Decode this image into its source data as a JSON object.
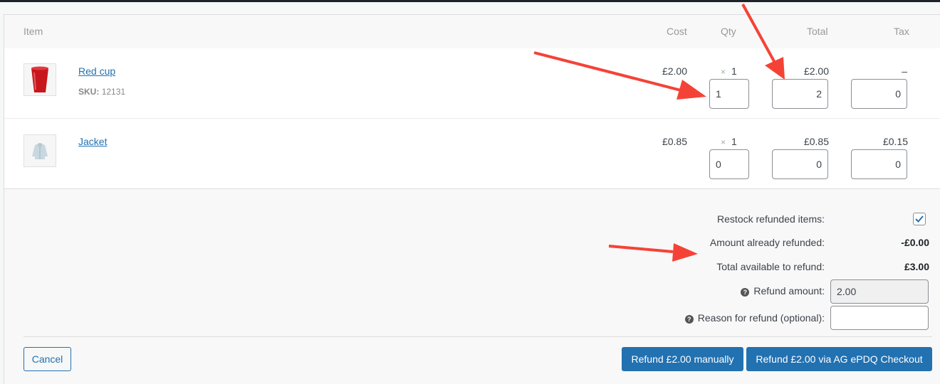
{
  "table": {
    "headers": {
      "item": "Item",
      "cost": "Cost",
      "qty": "Qty",
      "total": "Total",
      "tax": "Tax"
    },
    "rows": [
      {
        "name": "Red cup",
        "sku_label": "SKU:",
        "sku_value": "12131",
        "cost": "£2.00",
        "qty_prefix": "×",
        "qty": "1",
        "total": "£2.00",
        "tax": "–",
        "refund_qty": "1",
        "refund_total": "2",
        "refund_tax": "0"
      },
      {
        "name": "Jacket",
        "cost": "£0.85",
        "qty_prefix": "×",
        "qty": "1",
        "total": "£0.85",
        "tax": "£0.15",
        "refund_qty": "0",
        "refund_total": "0",
        "refund_tax": "0"
      }
    ]
  },
  "refund": {
    "restock_label": "Restock refunded items:",
    "restock_checked": true,
    "already_refunded_label": "Amount already refunded:",
    "already_refunded_value": "-£0.00",
    "available_label": "Total available to refund:",
    "available_value": "£3.00",
    "amount_label": "Refund amount:",
    "amount_value": "2.00",
    "reason_label": "Reason for refund (optional):",
    "reason_value": ""
  },
  "actions": {
    "cancel": "Cancel",
    "refund_manual": "Refund £2.00 manually",
    "refund_gateway": "Refund £2.00 via AG ePDQ Checkout"
  },
  "colors": {
    "accent": "#2271b1",
    "annotation_arrow": "#f44336"
  }
}
